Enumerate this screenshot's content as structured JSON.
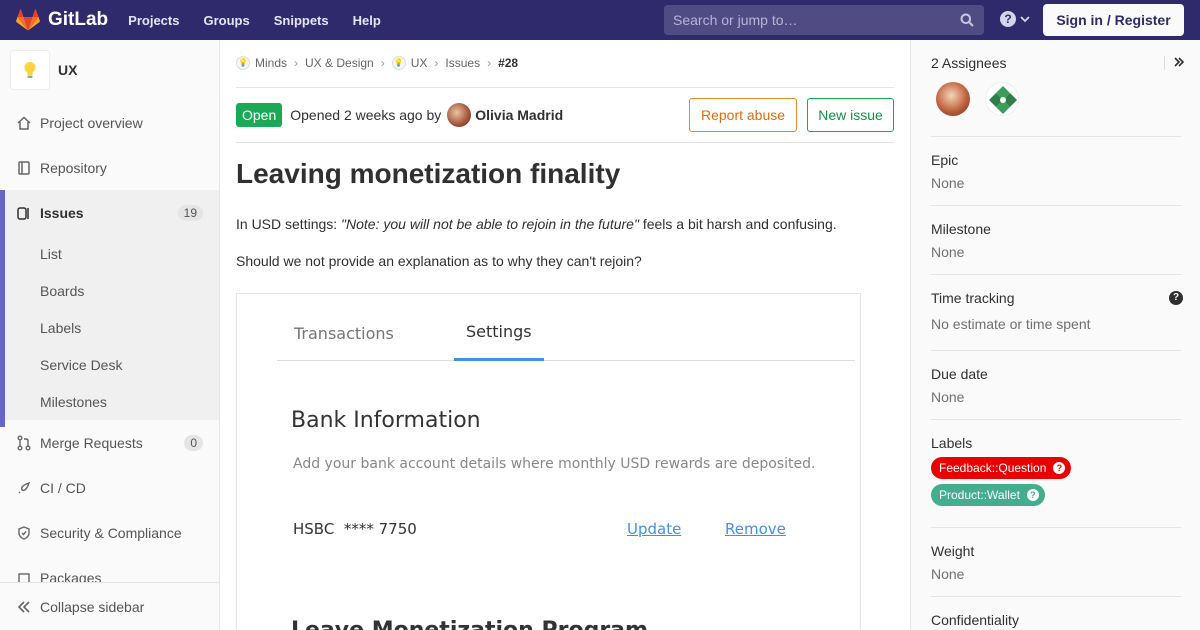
{
  "navbar": {
    "brand": "GitLab",
    "links": [
      "Projects",
      "Groups",
      "Snippets",
      "Help"
    ],
    "search_placeholder": "Search or jump to…",
    "help_glyph": "?",
    "signin_label": "Sign in / Register",
    "bg_color": "#2f2a6b"
  },
  "sidebar": {
    "project_name": "UX",
    "project_icon": "lightbulb-icon",
    "items": [
      {
        "label": "Project overview",
        "icon": "home-icon"
      },
      {
        "label": "Repository",
        "icon": "book-icon"
      },
      {
        "label": "Issues",
        "icon": "issues-icon",
        "count": "19"
      },
      {
        "label": "Merge Requests",
        "icon": "merge-request-icon",
        "count": "0"
      },
      {
        "label": "CI / CD",
        "icon": "rocket-icon"
      },
      {
        "label": "Security & Compliance",
        "icon": "shield-icon"
      },
      {
        "label": "Packages",
        "icon": "package-icon"
      }
    ],
    "issue_subitems": [
      "List",
      "Boards",
      "Labels",
      "Service Desk",
      "Milestones"
    ],
    "collapse_label": "Collapse sidebar"
  },
  "breadcrumb": [
    "Minds",
    "UX & Design",
    "UX",
    "Issues",
    "#28"
  ],
  "issue": {
    "status": "Open",
    "opened_text": "Opened 2 weeks ago by",
    "author": "Olivia Madrid",
    "report_abuse_label": "Report abuse",
    "new_issue_label": "New issue",
    "title": "Leaving monetization finality",
    "p1_prefix": "In USD settings: ",
    "p1_quote": "\"Note: you will not be able to rejoin in the future\"",
    "p1_suffix": " feels a bit harsh and confusing.",
    "p2": "Should we not provide an explanation as to why they can't rejoin?"
  },
  "screenshot": {
    "tabs": [
      "Transactions",
      "Settings"
    ],
    "active_tab": "Settings",
    "bank_heading": "Bank Information",
    "bank_sub": "Add your bank account details where monthly USD rewards are deposited.",
    "bank_account": "HSBC  **** 7750",
    "update_label": "Update",
    "remove_label": "Remove",
    "leave_heading": "Leave Monetization Program"
  },
  "right_sidebar": {
    "assignees_label": "2 Assignees",
    "epic_label": "Epic",
    "epic_value": "None",
    "milestone_label": "Milestone",
    "milestone_value": "None",
    "time_tracking_label": "Time tracking",
    "time_tracking_value": "No estimate or time spent",
    "due_date_label": "Due date",
    "due_date_value": "None",
    "labels_label": "Labels",
    "labels": [
      {
        "name": "Feedback::Question",
        "color": "#e90000"
      },
      {
        "name": "Product::Wallet",
        "color": "#44ad8e"
      }
    ],
    "weight_label": "Weight",
    "weight_value": "None",
    "confidentiality_label": "Confidentiality"
  }
}
